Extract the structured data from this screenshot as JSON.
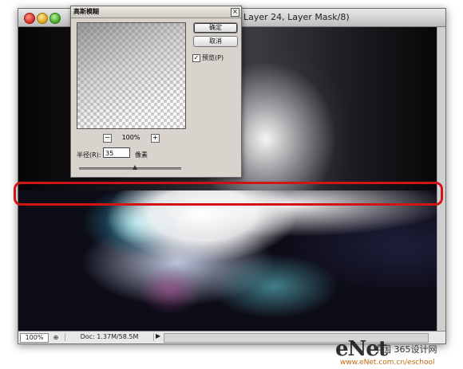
{
  "document": {
    "title": "Layer 24, Layer Mask/8)",
    "status": {
      "zoom": "100%",
      "doc_info": "Doc: 1.37M/58.5M",
      "status_icon": "⊕",
      "arrow": "▶"
    }
  },
  "dialog": {
    "title": "高斯模糊",
    "close": "×",
    "buttons": {
      "ok": "确定",
      "cancel": "取消"
    },
    "preview_checkbox": {
      "label": "预览(P)",
      "checked": true,
      "mark": "✓"
    },
    "zoom": {
      "minus": "−",
      "plus": "+",
      "value": "100%"
    },
    "radius": {
      "label": "半径(R):",
      "value": "35",
      "unit": "像素"
    },
    "slider_level_fraction": 0.55
  },
  "watermark": {
    "logo": "eNet",
    "chinese": "中国 365设计网",
    "url": "www.eNet.com.cn/eschool"
  },
  "colors": {
    "highlight": "#d21414",
    "dialog_bg": "#d8d4cd",
    "window_close": "#d12a1e",
    "window_min": "#d9a21a",
    "window_zoom": "#3ea220"
  }
}
